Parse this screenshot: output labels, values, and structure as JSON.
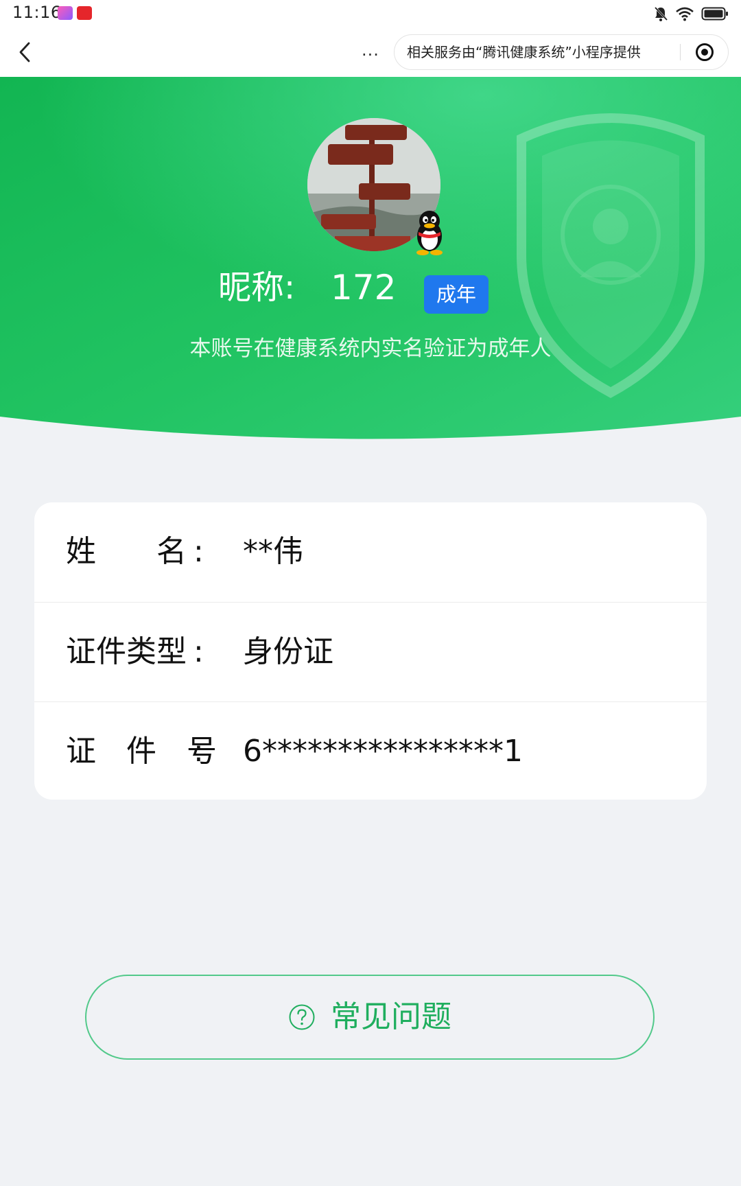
{
  "status_bar": {
    "time": "11:16",
    "icons": [
      "app-icon-1",
      "app-icon-2",
      "mute-icon",
      "wifi-icon",
      "battery-icon"
    ]
  },
  "title_bar": {
    "more_label": "...",
    "provider_text": "相关服务由“腾讯健康系统”小程序提供"
  },
  "profile": {
    "nickname_label": "昵称:",
    "nickname_value": "172",
    "age_badge": "成年",
    "verify_text": "本账号在健康系统内实名验证为成年人"
  },
  "info": {
    "rows": [
      {
        "label": "姓　　名",
        "colon": ":",
        "value": "**伟"
      },
      {
        "label": "证件类型",
        "colon": ":",
        "value": "身份证"
      },
      {
        "label": "证　件　号",
        "colon": ":",
        "value": "6****************1"
      }
    ]
  },
  "faq": {
    "label": "常见问题",
    "icon": "question-circle-icon"
  },
  "colors": {
    "hero_green_dark": "#12b552",
    "hero_green_light": "#38d27d",
    "badge_blue": "#1f78ee",
    "faq_green": "#1fae5e",
    "page_bg": "#f0f2f5"
  }
}
